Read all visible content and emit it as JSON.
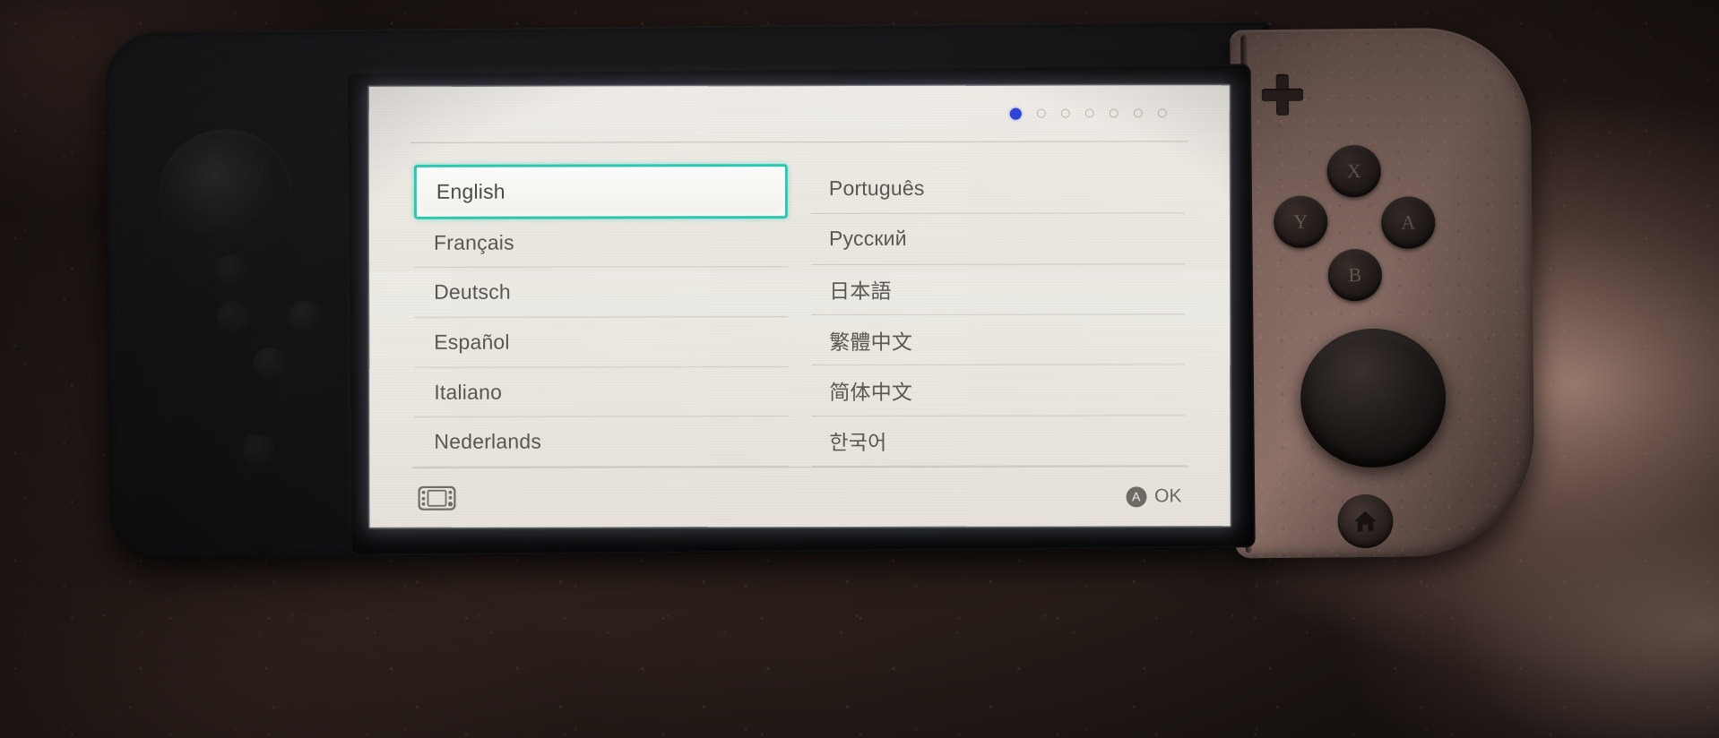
{
  "device": {
    "name": "Nintendo Switch handheld console",
    "right_joycon_buttons": [
      "X",
      "Y",
      "A",
      "B"
    ],
    "plus_button_label": "+",
    "home_button_icon": "home-icon"
  },
  "screen": {
    "page_indicator": {
      "total": 7,
      "active_index": 0,
      "active_color": "#2a45d8",
      "inactive_color": "#b9b5ad"
    },
    "selection": {
      "selected_label": "English",
      "highlight_color": "#29c8b2"
    },
    "languages": {
      "left_column": [
        "English",
        "Français",
        "Deutsch",
        "Español",
        "Italiano",
        "Nederlands"
      ],
      "right_column": [
        "Português",
        "Русский",
        "日本語",
        "繁體中文",
        "简体中文",
        "한국어"
      ]
    },
    "bottom_bar": {
      "left_icon": "switch-console-icon",
      "confirm_button_glyph": "A",
      "confirm_label": "OK"
    }
  }
}
